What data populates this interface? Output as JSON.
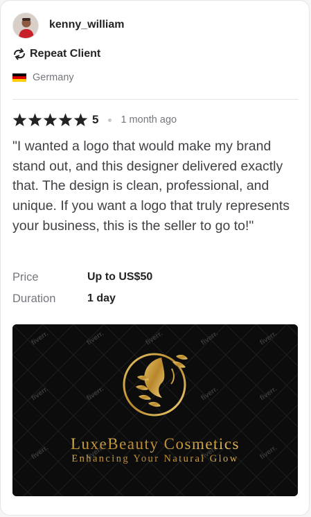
{
  "reviewer": {
    "username": "kenny_william",
    "badge": "Repeat Client",
    "country": "Germany",
    "avatar_icon": "avatar-photo"
  },
  "review": {
    "rating": "5",
    "stars": 5,
    "time_ago": "1 month ago",
    "text": "\"I wanted a logo that would make my brand stand out, and this designer delivered exactly that. The design is clean, professional, and unique. If you want a logo that truly represents your business, this is the seller to go to!\"",
    "details": [
      {
        "label": "Price",
        "value": "Up to US$50"
      },
      {
        "label": "Duration",
        "value": "1 day"
      }
    ]
  },
  "portfolio": {
    "brand_name": "LuxeBeauty Cosmetics",
    "tagline": "Enhancing Your Natural Glow",
    "watermark": "fiverr."
  },
  "colors": {
    "text_primary": "#222325",
    "text_secondary": "#74767e",
    "gold": "#c9a23b",
    "image_bg": "#0c0c0c"
  }
}
